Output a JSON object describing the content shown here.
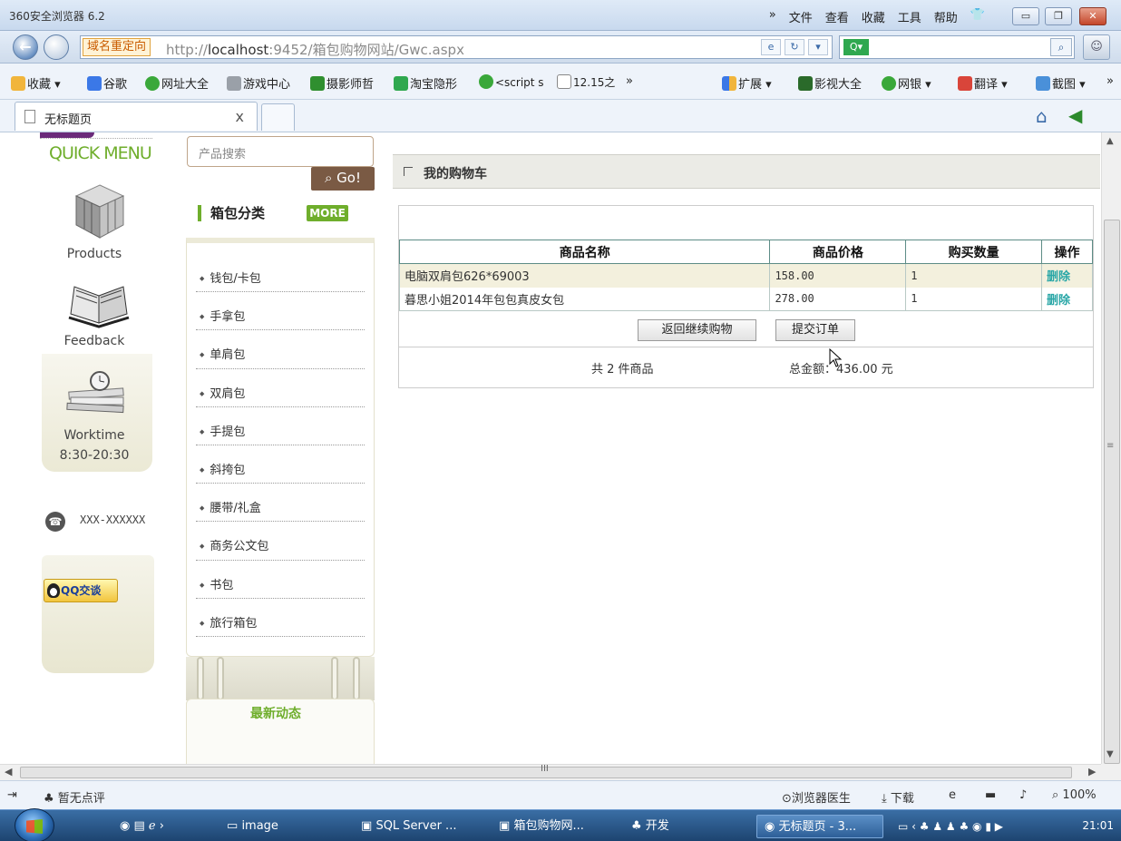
{
  "browser": {
    "title": "360安全浏览器 6.2",
    "menus": [
      "»",
      "文件",
      "查看",
      "收藏",
      "工具",
      "帮助"
    ],
    "redirect_tag": "域名重定向",
    "url_prefix": "http://",
    "url_host": "localhost",
    "url_rest": ":9452/箱包购物网站/Gwc.aspx",
    "search_placeholder": "",
    "favorites": [
      {
        "label": "收藏 ▾",
        "icon": "star-icon"
      },
      {
        "label": "谷歌",
        "icon": "google-icon"
      },
      {
        "label": "网址大全",
        "icon": "globe-icon"
      },
      {
        "label": "游戏中心",
        "icon": "gamepad-icon"
      },
      {
        "label": "摄影师哲",
        "icon": "douban-icon"
      },
      {
        "label": "淘宝隐形",
        "icon": "search-q-icon"
      },
      {
        "label": "<script s",
        "icon": "globe-icon"
      },
      {
        "label": "12.15之",
        "icon": "doc-icon"
      },
      {
        "label": "»",
        "icon": ""
      }
    ],
    "fav_right": [
      {
        "label": "扩展 ▾",
        "icon": "grid-icon"
      },
      {
        "label": "影视大全",
        "icon": "video-icon"
      },
      {
        "label": "网银 ▾",
        "icon": "bank-icon"
      },
      {
        "label": "翻译 ▾",
        "icon": "translate-icon"
      },
      {
        "label": "截图 ▾",
        "icon": "screenshot-icon"
      },
      {
        "label": "»",
        "icon": ""
      }
    ],
    "tab_title": "无标题页",
    "tab_close": "x"
  },
  "quick_menu": {
    "title": "QUICK MENU",
    "products": "Products",
    "feedback": "Feedback",
    "worktime_label": "Worktime",
    "worktime_hours": "8:30-20:30",
    "phone": "XXX-XXXXXX",
    "qq": "QQ交谈"
  },
  "category": {
    "search_placeholder": "产品搜索",
    "go": "Go!",
    "heading": "箱包分类",
    "more": "MORE",
    "items": [
      "钱包/卡包",
      "手拿包",
      "单肩包",
      "双肩包",
      "手提包",
      "斜挎包",
      "腰带/礼盒",
      "商务公文包",
      "书包",
      "旅行箱包"
    ],
    "news_title": "最新动态"
  },
  "cart": {
    "title": "我的购物车",
    "columns": [
      "商品名称",
      "商品价格",
      "购买数量",
      "操作"
    ],
    "rows": [
      {
        "name": "电脑双肩包626*69003",
        "price": "158.00",
        "qty": "1",
        "action": "删除"
      },
      {
        "name": "暮思小姐2014年包包真皮女包",
        "price": "278.00",
        "qty": "1",
        "action": "删除"
      }
    ],
    "continue_button": "返回继续购物",
    "submit_button": "提交订单",
    "count_text": "共 2 件商品",
    "total_text": "总金额：436.00 元"
  },
  "status_bar": {
    "rating": "暂无点评",
    "doctor": "浏览器医生",
    "download": "下载",
    "zoom": "100%"
  },
  "taskbar": {
    "items": [
      {
        "label": "image"
      },
      {
        "label": "SQL Server ..."
      },
      {
        "label": "箱包购物网..."
      },
      {
        "label": "开发"
      },
      {
        "label": "无标题页 - 3..."
      }
    ],
    "clock": "21:01"
  },
  "colors": {
    "accent_green": "#6fae2c",
    "delete_link": "#2aa7a7",
    "taskbar": "#1d4470"
  }
}
